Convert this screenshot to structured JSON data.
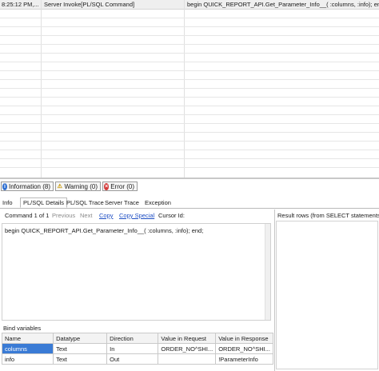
{
  "log": {
    "row": {
      "time": "8:25:12 PM,...",
      "event": "Server Invoke[PL/SQL Command]",
      "text": "begin QUICK_REPORT_API.Get_Parameter_Info__( :columns, :info); end;"
    }
  },
  "message_tabs": [
    {
      "label": "Information (8)",
      "icon": "info-icon",
      "color": "#2f6fd1"
    },
    {
      "label": "Warning (0)",
      "icon": "warning-icon",
      "color": "#e6b800"
    },
    {
      "label": "Error (0)",
      "icon": "error-icon",
      "color": "#d23a3a"
    }
  ],
  "detail_tabs": [
    "Info",
    "PL/SQL Details",
    "PL/SQL Trace",
    "Server Trace",
    "Exception"
  ],
  "command_bar": {
    "counter": "Command 1 of 1",
    "previous": "Previous",
    "next": "Next",
    "copy": "Copy",
    "copy_special": "Copy Special",
    "cursor_id": "Cursor Id:"
  },
  "sql_text": "begin QUICK_REPORT_API.Get_Parameter_Info__( :columns, :info); end;",
  "bind_variables": {
    "title": "Bind variables",
    "columns": [
      "Name",
      "Datatype",
      "Direction",
      "Value in Request",
      "Value in Response"
    ],
    "rows": [
      [
        "columns",
        "Text",
        "In",
        "ORDER_NO^SHI...",
        "ORDER_NO^SHI..."
      ],
      [
        "info",
        "Text",
        "Out",
        "",
        "!ParameterInfo"
      ]
    ]
  },
  "results": {
    "title": "Result rows (from SELECT statements)"
  }
}
